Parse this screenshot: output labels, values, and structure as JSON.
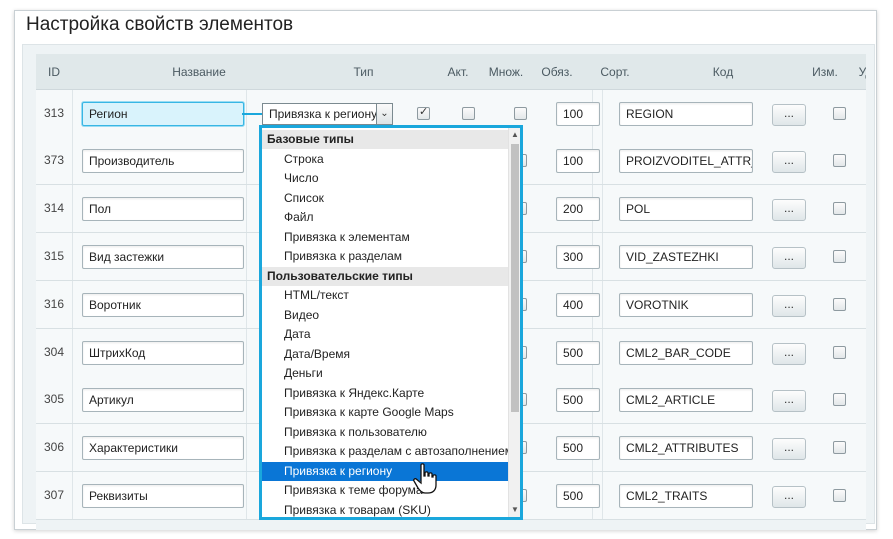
{
  "title": "Настройка свойств элементов",
  "columns": [
    "ID",
    "Название",
    "Тип",
    "Акт.",
    "Множ.",
    "Обяз.",
    "Сорт.",
    "Код",
    "Изм.",
    "Удал."
  ],
  "rows": [
    {
      "id": "313",
      "name": "Регион",
      "sort": "100",
      "code": "REGION",
      "active": true,
      "multiple": false,
      "required": false,
      "edit": "..."
    },
    {
      "id": "373",
      "name": "Производитель",
      "sort": "100",
      "code": "PROIZVODITEL_ATTR_E",
      "edit": "..."
    },
    {
      "id": "314",
      "name": "Пол",
      "sort": "200",
      "code": "POL",
      "edit": "..."
    },
    {
      "id": "315",
      "name": "Вид застежки",
      "sort": "300",
      "code": "VID_ZASTEZHKI",
      "edit": "..."
    },
    {
      "id": "316",
      "name": "Воротник",
      "sort": "400",
      "code": "VOROTNIK",
      "edit": "..."
    },
    {
      "id": "304",
      "name": "ШтрихКод",
      "sort": "500",
      "code": "CML2_BAR_CODE",
      "edit": "..."
    },
    {
      "id": "305",
      "name": "Артикул",
      "sort": "500",
      "code": "CML2_ARTICLE",
      "edit": "..."
    },
    {
      "id": "306",
      "name": "Характеристики",
      "sort": "500",
      "code": "CML2_ATTRIBUTES",
      "edit": "..."
    },
    {
      "id": "307",
      "name": "Реквизиты",
      "sort": "500",
      "code": "CML2_TRAITS",
      "edit": "..."
    }
  ],
  "type_select": {
    "value": "Привязка к региону"
  },
  "dropdown": {
    "groups": [
      {
        "label": "Базовые типы",
        "items": [
          "Строка",
          "Число",
          "Список",
          "Файл",
          "Привязка к элементам",
          "Привязка к разделам"
        ]
      },
      {
        "label": "Пользовательские типы",
        "items": [
          "HTML/текст",
          "Видео",
          "Дата",
          "Дата/Время",
          "Деньги",
          "Привязка к Яндекс.Карте",
          "Привязка к карте Google Maps",
          "Привязка к пользователю",
          "Привязка к разделам с автозаполнением",
          "Привязка к региону",
          "Привязка к теме форума",
          "Привязка к товарам (SKU)"
        ]
      }
    ],
    "selected": "Привязка к региону"
  },
  "colors": {
    "accent": "#1aa7dc",
    "selection": "#0a76d6",
    "header_bg": "#e0e8ea"
  }
}
